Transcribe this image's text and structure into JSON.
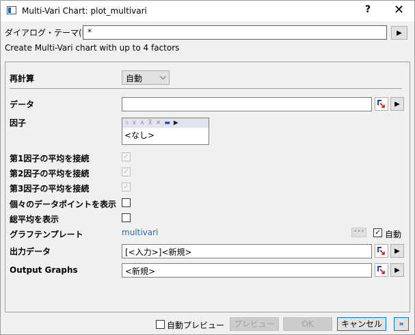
{
  "window": {
    "title": "Multi-Vari Chart: plot_multivari",
    "help": "?",
    "close": "✕"
  },
  "theme": {
    "label": "ダイアログ・テーマ(H)",
    "value": "*",
    "arrow": "▶"
  },
  "description": "Create Multi-Vari chart with up to 4 factors",
  "recalc": {
    "label": "再計算",
    "value": "自動"
  },
  "data": {
    "label": "データ",
    "value": ""
  },
  "factor": {
    "label": "因子",
    "items": [
      "<なし>"
    ]
  },
  "connect1": {
    "label": "第1因子の平均を接続",
    "checked": true,
    "enabled": false
  },
  "connect2": {
    "label": "第2因子の平均を接続",
    "checked": true,
    "enabled": false
  },
  "connect3": {
    "label": "第3因子の平均を接続",
    "checked": true,
    "enabled": false
  },
  "show_points": {
    "label": "個々のデータポイントを表示",
    "checked": false
  },
  "grand_mean": {
    "label": "総平均を表示",
    "checked": false
  },
  "template": {
    "label": "グラフテンプレート",
    "value": "multivari",
    "dots": "•••",
    "auto_label": "自動",
    "auto_checked": true
  },
  "output_data": {
    "label": "出力データ",
    "value": "[<入力>]<新規>"
  },
  "output_graphs": {
    "label": "Output Graphs",
    "value": "<新規>"
  },
  "footer": {
    "auto_preview": "自動プレビュー",
    "preview": "プレビュー",
    "ok": "OK",
    "cancel": "キャンセル",
    "expand": "»"
  },
  "colors": {
    "accent": "#0078d7",
    "link": "#1a6fc0"
  }
}
